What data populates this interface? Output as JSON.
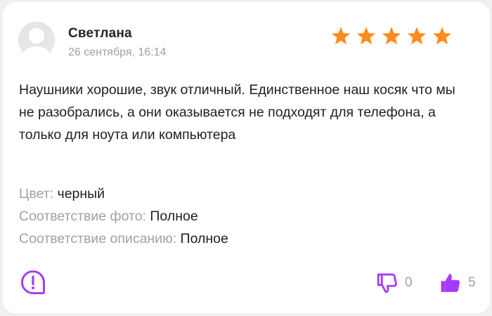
{
  "review": {
    "author": "Светлана",
    "date": "26 сентября, 16:14",
    "rating": 5,
    "rating_max": 5,
    "text": "Наушники хорошие, звук отличный. Единственное наш косяк что мы не разобрались, а они оказывается не подходят для телефона, а только для ноута или компьютера",
    "properties": [
      {
        "label": "Цвет:",
        "value": "черный"
      },
      {
        "label": "Соответствие фото:",
        "value": "Полное"
      },
      {
        "label": "Соответствие описанию:",
        "value": "Полное"
      }
    ]
  },
  "actions": {
    "report_icon": "exclamation-bubble-icon",
    "dislike_icon": "thumbs-down-icon",
    "dislike_count": "0",
    "like_icon": "thumbs-up-icon",
    "like_count": "5"
  },
  "colors": {
    "star": "#ff8c1a",
    "accent": "#a73afd",
    "muted": "#a0a0a8",
    "text": "#1f1f1f"
  }
}
